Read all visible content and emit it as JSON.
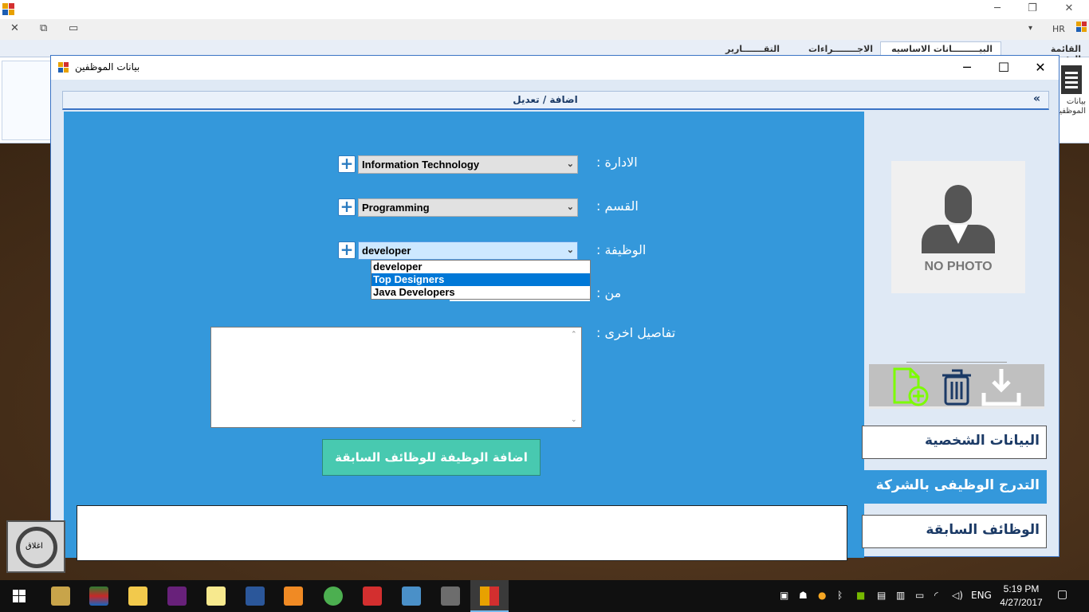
{
  "app": {
    "lang_indicator": "HR",
    "controls": {
      "minimize": "─",
      "restore": "❐",
      "close": "✕"
    },
    "mdi_controls": {
      "close": "✕",
      "restore": "⧉",
      "minimize": "▭",
      "pin": "▾"
    }
  },
  "ribbon": {
    "tabs": [
      {
        "label": "القائمة الرئيسيه",
        "active": false
      },
      {
        "label": "البيـــــــــانات الاساسيه",
        "active": true
      },
      {
        "label": "الاجــــــــراءات",
        "active": false
      },
      {
        "label": "التقـــــــارير",
        "active": false
      }
    ],
    "side_button_label": "بيانات الموظفين"
  },
  "form": {
    "title": "بيانات الموظفين",
    "section_title": "اضافة / تعديل",
    "collapse_icon": "«",
    "controls": {
      "minimize": "─",
      "maximize": "☐",
      "close": "✕"
    }
  },
  "fields": {
    "department": {
      "label": "الادارة :",
      "value": "Information Technology"
    },
    "section": {
      "label": "القسم :",
      "value": "Programming"
    },
    "job": {
      "label": "الوظيفة :",
      "value": "developer"
    },
    "from": {
      "label": "من :"
    },
    "details": {
      "label": "تفاصيل اخرى :",
      "value": ""
    }
  },
  "job_dropdown": {
    "options": [
      "developer",
      "Top Designers",
      "Java Developers"
    ],
    "highlighted_index": 1
  },
  "add_job_button": "اضافة الوظيفة للوظائف السابقة",
  "photo": {
    "placeholder_text": "NO PHOTO"
  },
  "side_nav": [
    {
      "label": "البيانات الشخصية",
      "active": false
    },
    {
      "label": "التدرج الوظيفى بالشركة",
      "active": true
    },
    {
      "label": "الوظائف السابقة",
      "active": false
    }
  ],
  "close_button": "اغلاق",
  "taskbar": {
    "language": "ENG",
    "time": "5:19 PM",
    "date": "4/27/2017"
  },
  "colors": {
    "panel_blue": "#3498db",
    "button_teal": "#48c9b0",
    "header_navy": "#1b3a66"
  }
}
